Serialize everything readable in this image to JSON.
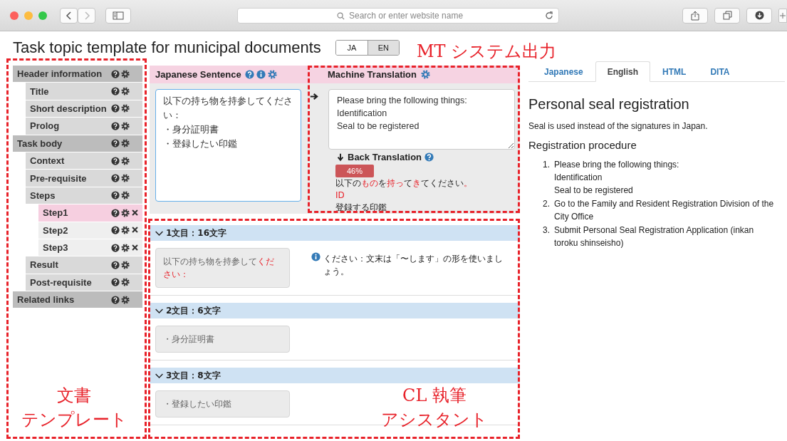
{
  "browser": {
    "address_placeholder": "Search or enter website name"
  },
  "page_title": "Task topic template for municipal documents",
  "language_toggle": [
    {
      "label": "JA",
      "selected": false
    },
    {
      "label": "EN",
      "selected": true
    }
  ],
  "sidebar": {
    "items": [
      {
        "label": "Header information",
        "selected": false,
        "children": [
          {
            "label": "Title",
            "selected": false
          },
          {
            "label": "Short description",
            "selected": false
          },
          {
            "label": "Prolog",
            "selected": false
          }
        ]
      },
      {
        "label": "Task body",
        "selected": false,
        "children": [
          {
            "label": "Context",
            "selected": false
          },
          {
            "label": "Pre-requisite",
            "selected": false
          },
          {
            "label": "Steps",
            "selected": false,
            "children": [
              {
                "label": "Step1",
                "selected": true,
                "deletable": true
              },
              {
                "label": "Step2",
                "selected": false,
                "deletable": true
              },
              {
                "label": "Step3",
                "selected": false,
                "deletable": true
              }
            ]
          },
          {
            "label": "Result",
            "selected": false
          },
          {
            "label": "Post-requisite",
            "selected": false
          }
        ]
      },
      {
        "label": "Related links",
        "selected": false
      }
    ]
  },
  "editor": {
    "source_heading": "Japanese Sentence",
    "source_lines": [
      "以下の持ち物を持参してください：",
      "・身分証明書",
      "・登録したい印鑑"
    ],
    "mt_heading": "Machine Translation",
    "mt_text": "Please bring the following things:\nIdentification\nSeal to be registered",
    "back_translation": {
      "heading": "Back Translation",
      "score": "46%",
      "lines": [
        [
          {
            "text": "以下の",
            "flagged": false
          },
          {
            "text": "もの",
            "flagged": true
          },
          {
            "text": "を",
            "flagged": false
          },
          {
            "text": "持っ",
            "flagged": true
          },
          {
            "text": "て",
            "flagged": false
          },
          {
            "text": "き",
            "flagged": true
          },
          {
            "text": "てください",
            "flagged": false
          },
          {
            "text": "。",
            "flagged": true
          }
        ],
        [
          {
            "text": "ID",
            "flagged": true
          }
        ],
        [
          {
            "text": "登録する印鑑",
            "flagged": false
          }
        ]
      ]
    }
  },
  "sentences": [
    {
      "heading": "1文目：16文字",
      "expanded": true,
      "segments": [
        {
          "text": "以下の持ち物を持参して",
          "flagged": false
        },
        {
          "text": "ください：",
          "flagged": true
        }
      ],
      "advice": "ください：文末は「〜します」の形を使いましょう。"
    },
    {
      "heading": "2文目：6文字",
      "expanded": true,
      "segments": [
        {
          "text": "・身分証明書",
          "flagged": false
        }
      ]
    },
    {
      "heading": "3文目：8文字",
      "expanded": true,
      "segments": [
        {
          "text": "・登録したい印鑑",
          "flagged": false
        }
      ]
    }
  ],
  "preview": {
    "tabs": [
      {
        "label": "Japanese",
        "selected": false
      },
      {
        "label": "English",
        "selected": true
      },
      {
        "label": "HTML",
        "selected": false
      },
      {
        "label": "DITA",
        "selected": false
      }
    ],
    "title": "Personal seal registration",
    "intro": "Seal is used instead of the signatures in Japan.",
    "section_title": "Registration procedure",
    "steps": [
      {
        "number": "1.",
        "lines": [
          "Please bring the following things:",
          "Identification",
          "Seal to be registered"
        ]
      },
      {
        "number": "2.",
        "lines": [
          "Go to the Family and Resident Registration Division of the City Office"
        ]
      },
      {
        "number": "3.",
        "lines": [
          "Submit Personal Seal Registration Application (inkan toroku shinseisho)"
        ]
      }
    ]
  },
  "annotations": [
    {
      "lines": [
        "文書",
        "テンプレート"
      ]
    },
    {
      "lines": [
        "MT システム出力"
      ]
    },
    {
      "lines": [
        "CL 執筆",
        "アシスタント"
      ]
    }
  ]
}
